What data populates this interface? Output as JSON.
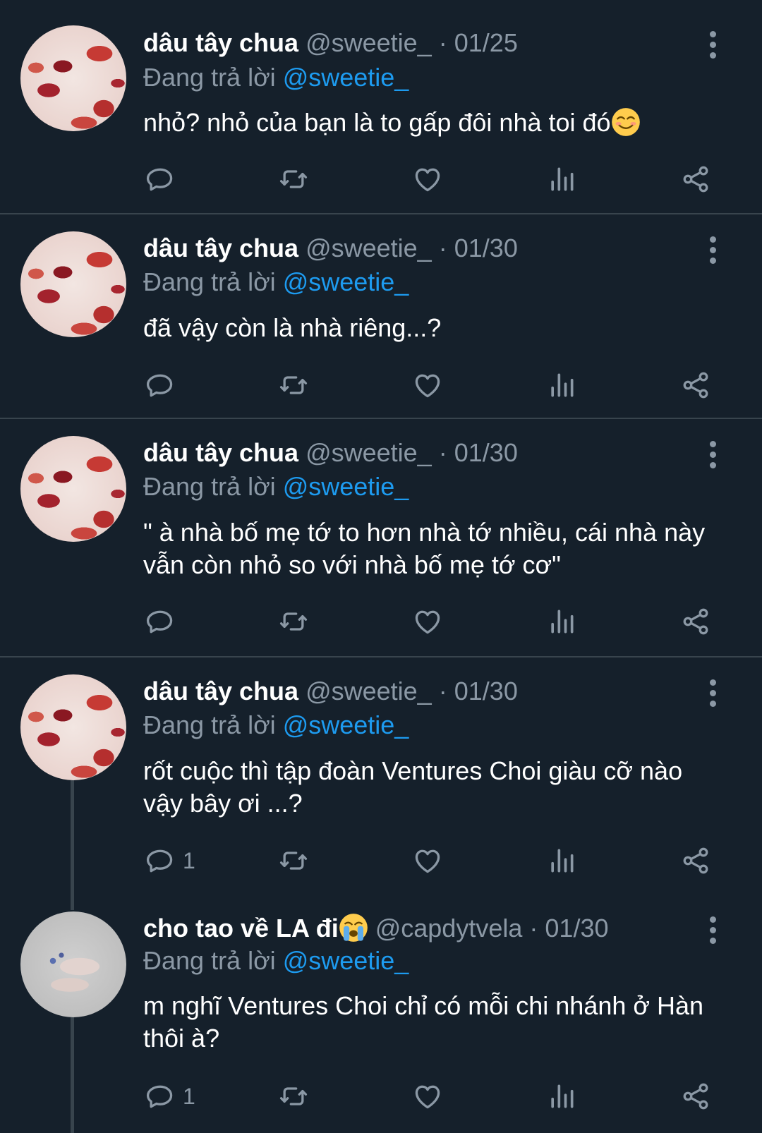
{
  "tweets": [
    {
      "name": "dâu tây chua",
      "handle": "@sweetie_",
      "dot": "·",
      "date": "01/25",
      "reply_prefix": "Đang trả lời",
      "reply_to": "@sweetie_",
      "text": "nhỏ? nhỏ của bạn là to gấp đôi nhà toi đó",
      "avatar": "strawberry-avatar"
    },
    {
      "name": "dâu tây chua",
      "handle": "@sweetie_",
      "dot": "·",
      "date": "01/30",
      "reply_prefix": "Đang trả lời",
      "reply_to": "@sweetie_",
      "text": "đã vậy còn là nhà riêng...?",
      "avatar": "strawberry-avatar"
    },
    {
      "name": "dâu tây chua",
      "handle": "@sweetie_",
      "dot": "·",
      "date": "01/30",
      "reply_prefix": "Đang trả lời",
      "reply_to": "@sweetie_",
      "text": "\" à nhà bố mẹ tớ to hơn nhà tớ nhiều, cái nhà này vẫn còn nhỏ so với nhà bố mẹ tớ cơ\"",
      "avatar": "strawberry-avatar"
    },
    {
      "name": "dâu tây chua",
      "handle": "@sweetie_",
      "dot": "·",
      "date": "01/30",
      "reply_prefix": "Đang trả lời",
      "reply_to": "@sweetie_",
      "text": "rốt cuộc thì tập đoàn Ventures Choi giàu cỡ nào vậy bây ơi ...?",
      "reply_count": "1",
      "avatar": "strawberry-avatar"
    },
    {
      "name": "cho tao về LA đi",
      "handle": "@capdytvela",
      "dot": "·",
      "date": "01/30",
      "reply_prefix": "Đang trả lời",
      "reply_to": "@sweetie_",
      "text": "m nghĩ Ventures Choi chỉ có mỗi chi nhánh ở Hàn thôi à?",
      "reply_count": "1",
      "avatar": "hand-avatar"
    }
  ],
  "icons": {
    "reply": "reply-icon",
    "retweet": "retweet-icon",
    "like": "heart-icon",
    "views": "views-icon",
    "share": "share-icon",
    "more": "more-options-icon"
  },
  "colors": {
    "background": "#15202b",
    "mention": "#1d9bf0",
    "muted": "#8b98a5",
    "divider": "#38444d"
  }
}
